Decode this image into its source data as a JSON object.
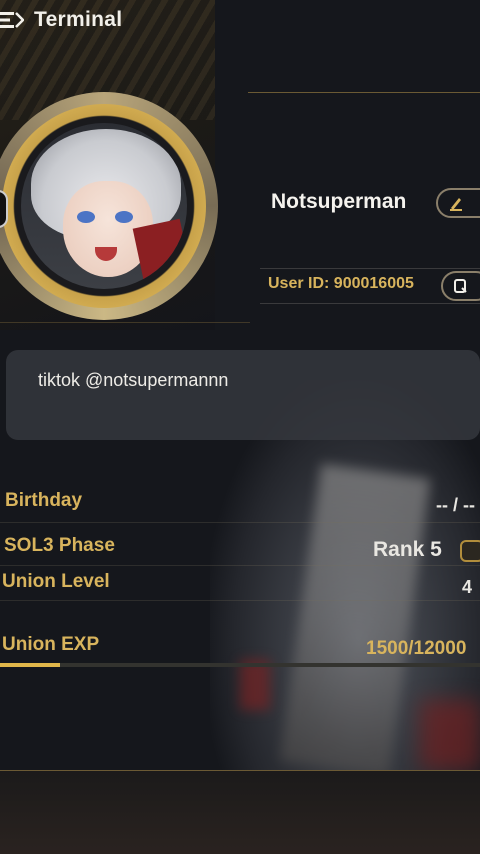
{
  "header": {
    "title": "Terminal"
  },
  "profile": {
    "username": "Notsuperman",
    "user_id": "User ID: 900016005",
    "bio": "tiktok @notsupermannn"
  },
  "details": {
    "birthday_label": "Birthday",
    "birthday_value": "-- / --",
    "sol3_label": "SOL3 Phase",
    "sol3_value": "Rank 5",
    "union_level_label": "Union Level",
    "union_level_value": "4",
    "union_exp_label": "Union EXP",
    "union_exp_value": "1500/12000",
    "union_exp_progress": 0.125
  },
  "colors": {
    "accent": "#d8b45d",
    "text": "#f2f0ea",
    "background": "#15171c"
  },
  "icons": {
    "menu": "menu-icon",
    "edit": "edit-pencil-icon",
    "copy": "copy-icon",
    "rank": "rank-badge-icon"
  }
}
